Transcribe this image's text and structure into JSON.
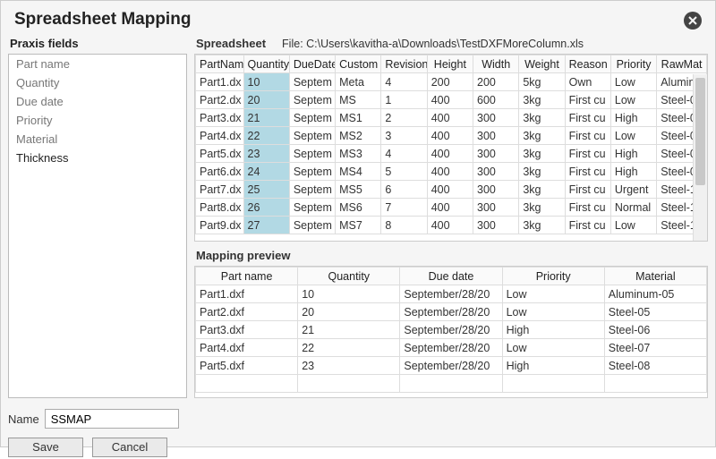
{
  "dialog": {
    "title": "Spreadsheet Mapping"
  },
  "praxis": {
    "label": "Praxis fields",
    "fields": [
      {
        "label": "Part name",
        "mapped": true
      },
      {
        "label": "Quantity",
        "mapped": true
      },
      {
        "label": "Due date",
        "mapped": true
      },
      {
        "label": "Priority",
        "mapped": true
      },
      {
        "label": "Material",
        "mapped": true
      },
      {
        "label": "Thickness",
        "mapped": false
      }
    ]
  },
  "spreadsheet": {
    "label": "Spreadsheet",
    "file_label": "File:",
    "file_path": "C:\\Users\\kavitha-a\\Downloads\\TestDXFMoreColumn.xls",
    "columns": [
      "PartNam",
      "Quantity",
      "DueDate",
      "Custom",
      "Revision",
      "Height",
      "Width",
      "Weight",
      "Reason",
      "Priority",
      "RawMat"
    ],
    "highlight_col_index": 1,
    "rows": [
      [
        "Part1.dx",
        "10",
        "Septem",
        "Meta",
        "4",
        "200",
        "200",
        "5kg",
        "Own",
        "Low",
        "Alumin"
      ],
      [
        "Part2.dx",
        "20",
        "Septem",
        "MS",
        "1",
        "400",
        "600",
        "3kg",
        "First cu",
        "Low",
        "Steel-0"
      ],
      [
        "Part3.dx",
        "21",
        "Septem",
        "MS1",
        "2",
        "400",
        "300",
        "3kg",
        "First cu",
        "High",
        "Steel-0"
      ],
      [
        "Part4.dx",
        "22",
        "Septem",
        "MS2",
        "3",
        "400",
        "300",
        "3kg",
        "First cu",
        "Low",
        "Steel-0"
      ],
      [
        "Part5.dx",
        "23",
        "Septem",
        "MS3",
        "4",
        "400",
        "300",
        "3kg",
        "First cu",
        "High",
        "Steel-0"
      ],
      [
        "Part6.dx",
        "24",
        "Septem",
        "MS4",
        "5",
        "400",
        "300",
        "3kg",
        "First cu",
        "High",
        "Steel-0"
      ],
      [
        "Part7.dx",
        "25",
        "Septem",
        "MS5",
        "6",
        "400",
        "300",
        "3kg",
        "First cu",
        "Urgent",
        "Steel-1"
      ],
      [
        "Part8.dx",
        "26",
        "Septem",
        "MS6",
        "7",
        "400",
        "300",
        "3kg",
        "First cu",
        "Normal",
        "Steel-1"
      ],
      [
        "Part9.dx",
        "27",
        "Septem",
        "MS7",
        "8",
        "400",
        "300",
        "3kg",
        "First cu",
        "Low",
        "Steel-1"
      ]
    ]
  },
  "preview": {
    "label": "Mapping preview",
    "columns": [
      "Part name",
      "Quantity",
      "Due date",
      "Priority",
      "Material"
    ],
    "rows": [
      [
        "Part1.dxf",
        "10",
        "September/28/20",
        "Low",
        "Aluminum-05"
      ],
      [
        "Part2.dxf",
        "20",
        "September/28/20",
        "Low",
        "Steel-05"
      ],
      [
        "Part3.dxf",
        "21",
        "September/28/20",
        "High",
        "Steel-06"
      ],
      [
        "Part4.dxf",
        "22",
        "September/28/20",
        "Low",
        "Steel-07"
      ],
      [
        "Part5.dxf",
        "23",
        "September/28/20",
        "High",
        "Steel-08"
      ],
      [
        "",
        "",
        "",
        "",
        ""
      ]
    ]
  },
  "footer": {
    "name_label": "Name",
    "name_value": "SSMAP",
    "save_label": "Save",
    "cancel_label": "Cancel"
  }
}
